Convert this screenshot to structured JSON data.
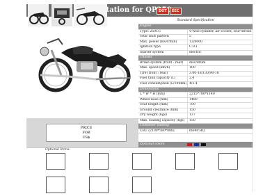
{
  "header": {
    "title": "Quotation for QP250",
    "badges": [
      "DOT",
      "EEC"
    ],
    "accent": "#d22b1f",
    "bar_color": "#6f6f6f"
  },
  "price_box": {
    "lines": [
      "PRICE",
      "FOB",
      "US$"
    ]
  },
  "spec": {
    "heading": "Standard Specification",
    "sections": [
      {
        "title": "Engine",
        "rows": [
          [
            "Type: 250CC",
            "V-twin-cylinder, air-cooled, four-stroke"
          ],
          [
            "Gear shift pattern",
            "5"
          ],
          [
            "Max. power (kw/r/min)",
            "12/8000"
          ],
          [
            "Ignition type",
            "C.D.I"
          ],
          [
            "Starter system",
            "electric"
          ]
        ]
      },
      {
        "title": "Chassis",
        "rows": [
          [
            "Brake system (front : rear)",
            "disc/drum"
          ],
          [
            "Max. speed (km/h)",
            "100"
          ],
          [
            "Tire (front : rear)",
            "3.00-18/130/90-18"
          ],
          [
            "Fuel tank capacity (L)",
            "2.4"
          ],
          [
            "Fuel consumption (L/100km)",
            "4/2.4"
          ]
        ]
      },
      {
        "title": "Dimensions",
        "rows": [
          [
            "L * W * H (mm)",
            "2215*780*1140"
          ],
          [
            "Wheel base (mm)",
            "1480"
          ],
          [
            "Seat height (mm)",
            "700"
          ],
          [
            "Ground clearance (mm)",
            "150"
          ],
          [
            "Dry weight (kgs)",
            "137"
          ],
          [
            "Max. loading capacity (kgs)",
            "150"
          ]
        ]
      },
      {
        "title": "Container loading",
        "rows": [
          [
            "CBU (2100*580*880)",
            "69/40'HQ"
          ]
        ]
      }
    ],
    "optional_colors_label": "Optional colors",
    "colors": [
      "#d4141a",
      "#1f2f9e",
      "#111111"
    ]
  },
  "optional_items_label": "Optional Items:"
}
